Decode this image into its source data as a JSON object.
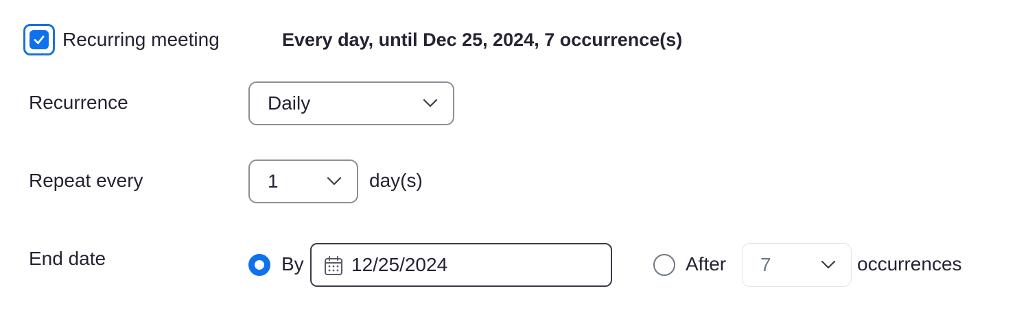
{
  "recurring": {
    "checked": true,
    "label": "Recurring meeting",
    "summary": "Every day, until Dec 25, 2024, 7 occurrence(s)"
  },
  "recurrence": {
    "label": "Recurrence",
    "selected": "Daily"
  },
  "repeat_every": {
    "label": "Repeat every",
    "selected": "1",
    "unit": "day(s)"
  },
  "end_date": {
    "label": "End date",
    "by": {
      "label": "By",
      "selected": true,
      "date_value": "12/25/2024"
    },
    "after": {
      "label": "After",
      "selected": false,
      "count": "7",
      "unit": "occurrences"
    }
  },
  "colors": {
    "accent": "#0e72ed",
    "text": "#232333",
    "border": "#8d8d99"
  }
}
